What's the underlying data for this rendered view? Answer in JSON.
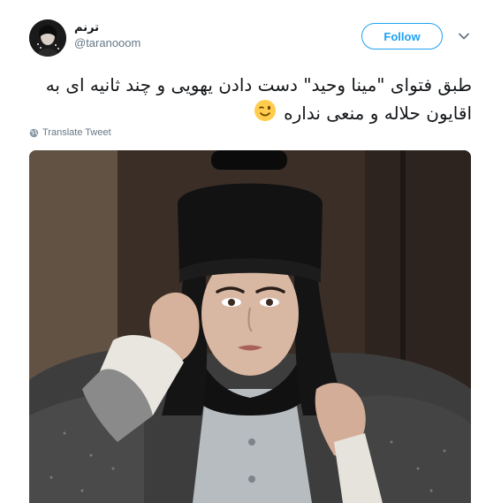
{
  "author": {
    "display_name": "ترنم",
    "handle": "@taranooom"
  },
  "actions": {
    "follow_label": "Follow"
  },
  "tweet": {
    "line1": "طبق فتوای \"مینا وحید\" دست دادن یهویی و چند ثانیه ای به",
    "line2": "اقایون حلاله و منعی نداره"
  },
  "translate": {
    "label": "Translate Tweet"
  },
  "icons": {
    "chevron": "chevron-down-icon",
    "globe": "globe-icon",
    "emoji": "winking-face-emoji-icon"
  },
  "colors": {
    "brand_blue": "#1da1f2",
    "secondary_text": "#657786",
    "primary_text": "#14171a"
  }
}
